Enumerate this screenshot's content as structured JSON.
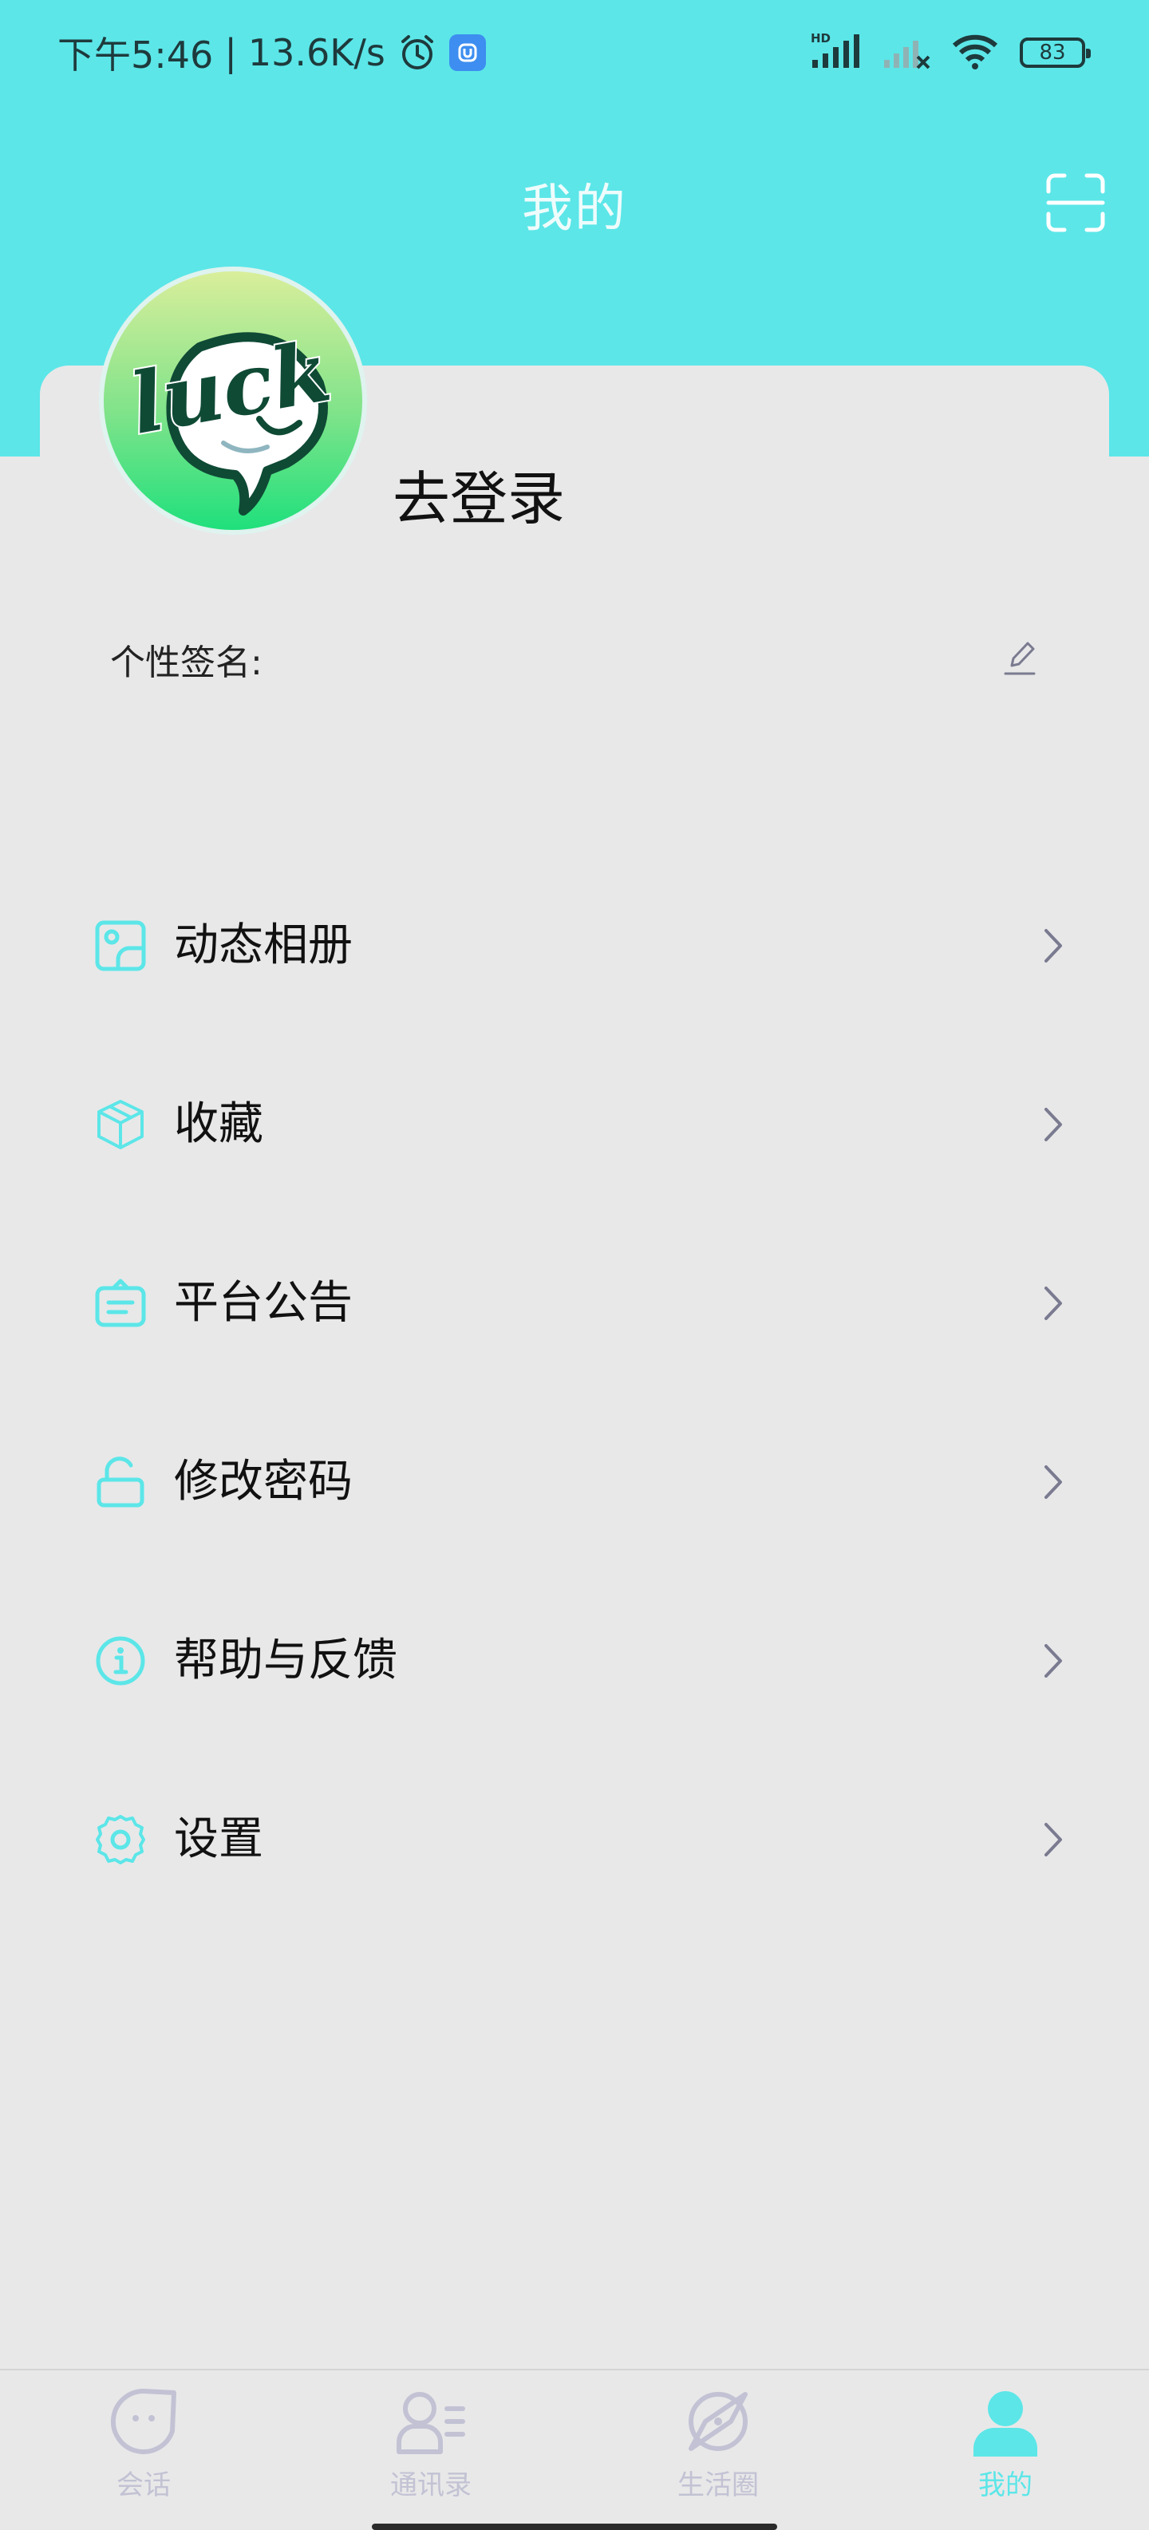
{
  "status_bar": {
    "time": "下午5:46",
    "separator": "|",
    "net_speed": "13.6K/s",
    "network_badge": "HD",
    "battery": "83",
    "icons": [
      "alarm-icon",
      "app-badge-icon",
      "signal-icon",
      "signal-off-icon",
      "wifi-icon",
      "battery-icon"
    ]
  },
  "header": {
    "title": "我的",
    "scan_icon": "scan-icon"
  },
  "profile": {
    "avatar_text": "luck",
    "login_label": "去登录",
    "signature_label": "个性签名:",
    "edit_icon": "pencil-icon"
  },
  "menu": {
    "items": [
      {
        "label": "动态相册",
        "icon": "photo-album-icon"
      },
      {
        "label": "收藏",
        "icon": "box-icon"
      },
      {
        "label": "平台公告",
        "icon": "notice-icon"
      },
      {
        "label": "修改密码",
        "icon": "lock-icon"
      },
      {
        "label": "帮助与反馈",
        "icon": "info-icon"
      },
      {
        "label": "设置",
        "icon": "gear-icon"
      }
    ]
  },
  "tabs": [
    {
      "label": "会话",
      "icon": "chat-icon",
      "active": false
    },
    {
      "label": "通讯录",
      "icon": "contacts-icon",
      "active": false
    },
    {
      "label": "生活圈",
      "icon": "compass-icon",
      "active": false
    },
    {
      "label": "我的",
      "icon": "person-icon",
      "active": true
    }
  ],
  "colors": {
    "accent": "#5ce6e8",
    "background": "#e8e8e9",
    "tab_inactive": "#c2c2d4",
    "chevron": "#7a7a90"
  }
}
